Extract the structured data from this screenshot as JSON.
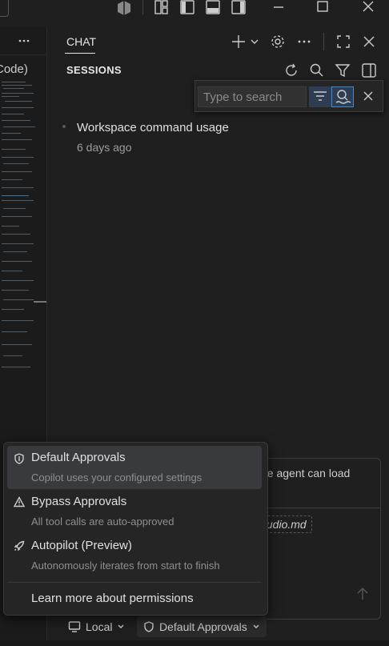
{
  "left_editor": {
    "tab_label": "Code)"
  },
  "chat": {
    "tab_label": "CHAT",
    "sessions_title": "SESSIONS",
    "search": {
      "placeholder": "Type to search"
    },
    "sessions": [
      {
        "title": "Workspace command usage",
        "time": "6 days ago"
      }
    ]
  },
  "input": {
    "text_fragment": "he agent can load",
    "file_chip": "tudio.md"
  },
  "bottom_bar": {
    "local_label": "Local",
    "approvals_label": "Default Approvals"
  },
  "menu": {
    "items": [
      {
        "title": "Default Approvals",
        "description": "Copilot uses your configured settings",
        "icon": "shield-icon",
        "selected": true
      },
      {
        "title": "Bypass Approvals",
        "description": "All tool calls are auto-approved",
        "icon": "warning-icon",
        "selected": false
      },
      {
        "title": "Autopilot (Preview)",
        "description": "Autonomously iterates from start to finish",
        "icon": "rocket-icon",
        "selected": false
      }
    ],
    "learn_more": "Learn more about permissions"
  },
  "colors": {
    "accent": "#3b8cd8",
    "selected_bg": "#383a3d",
    "panel_bg": "#1f1f1f"
  }
}
